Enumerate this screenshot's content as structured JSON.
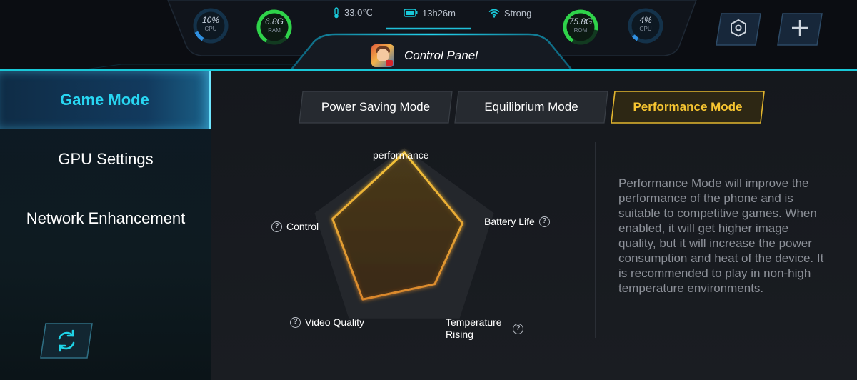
{
  "status_bar": {
    "cpu": {
      "value": "10%",
      "label": "CPU",
      "fraction": 0.1
    },
    "ram": {
      "value": "6.8G",
      "label": "RAM",
      "fraction": 0.78
    },
    "temperature": "33.0℃",
    "battery": "13h26m",
    "signal": "Strong",
    "rom": {
      "value": "75.8G",
      "label": "ROM",
      "fraction": 0.7
    },
    "gpu": {
      "value": "4%",
      "label": "GPU",
      "fraction": 0.04
    }
  },
  "header": {
    "title": "Control Panel"
  },
  "sidebar": {
    "items": [
      {
        "label": "Game Mode",
        "active": true
      },
      {
        "label": "GPU Settings",
        "active": false
      },
      {
        "label": "Network Enhancement",
        "active": false
      }
    ]
  },
  "modes": {
    "items": [
      {
        "label": "Power Saving Mode",
        "active": false
      },
      {
        "label": "Equilibrium Mode",
        "active": false
      },
      {
        "label": "Performance Mode",
        "active": true
      }
    ]
  },
  "radar": {
    "axes": [
      "performance",
      "Battery Life",
      "Temperature Rising",
      "Video Quality",
      "Control"
    ],
    "max_level": 1.0,
    "current_level": [
      0.95,
      0.65,
      0.55,
      0.75,
      0.8
    ]
  },
  "description": "Performance Mode will improve the performance of the phone and is suitable to competitive games. When enabled, it will get higher image quality, but it will increase the power consumption and heat of the device. It is recommended to play in non-high temperature environments.",
  "colors": {
    "accent_cyan": "#19c8d8",
    "active_gold": "#f7c531",
    "ram_green": "#2fd34a",
    "cpu_blue": "#2f8fe0"
  },
  "icons": {
    "settings": "hexagon-settings-icon",
    "add": "plus-icon",
    "refresh": "refresh-icon",
    "help": "question-circle-icon"
  }
}
